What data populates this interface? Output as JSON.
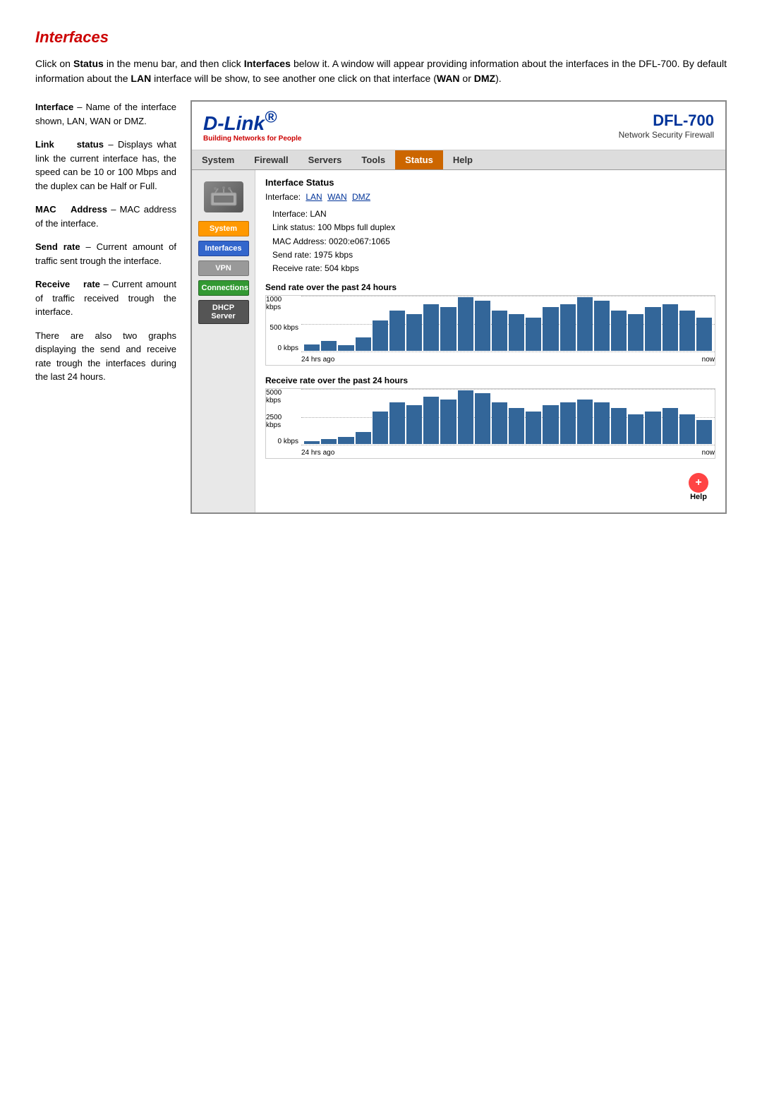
{
  "page": {
    "title": "Interfaces",
    "intro": "Click on Status in the menu bar, and then click Interfaces below it. A window will appear providing information about the interfaces in the DFL-700. By default information about the LAN interface will be show, to see another one click on that interface (WAN or DMZ).",
    "descriptions": [
      {
        "term": "Interface",
        "definition": "– Name of the interface shown, LAN, WAN or DMZ."
      },
      {
        "term": "Link status",
        "definition": "– Displays what link the current interface has, the speed can be 10 or 100 Mbps and the duplex can be Half or Full."
      },
      {
        "term": "MAC Address",
        "definition": "– MAC address of the interface."
      },
      {
        "term": "Send rate",
        "definition": "– Current amount of traffic sent trough the interface."
      },
      {
        "term": "Receive rate",
        "definition": "– Current amount of traffic received trough the interface."
      }
    ],
    "closing_text": "There are also two graphs displaying the send and receive rate trough the interfaces during the last 24 hours."
  },
  "dlink_ui": {
    "logo": "D-Link",
    "logo_r": "®",
    "tagline": "Building Networks for People",
    "product_model": "DFL-700",
    "product_desc": "Network Security Firewall",
    "nav_items": [
      "System",
      "Firewall",
      "Servers",
      "Tools",
      "Status",
      "Help"
    ],
    "active_nav": "Status",
    "sidebar_items": [
      {
        "label": "System",
        "style": "orange"
      },
      {
        "label": "Interfaces",
        "style": "blue"
      },
      {
        "label": "VPN",
        "style": "gray"
      },
      {
        "label": "Connections",
        "style": "green"
      },
      {
        "label": "DHCP Server",
        "style": "dark"
      }
    ],
    "interface_status": {
      "title": "Interface Status",
      "interface_label": "Interface:",
      "interface_links": [
        "LAN",
        "WAN",
        "DMZ"
      ],
      "active_interface": "LAN",
      "details": [
        "Interface: LAN",
        "Link status: 100 Mbps full duplex",
        "MAC Address: 0020:e067:1065",
        "Send rate: 1975 kbps",
        "Receive rate: 504 kbps"
      ]
    },
    "send_chart": {
      "title": "Send rate over the past 24 hours",
      "y_labels": [
        "1000 kbps",
        "500 kbps",
        "0 kbps"
      ],
      "x_labels": [
        "24 hrs ago",
        "now"
      ],
      "bars": [
        10,
        15,
        8,
        20,
        45,
        60,
        55,
        70,
        65,
        80,
        75,
        60,
        55,
        50,
        65,
        70,
        80,
        75,
        60,
        55,
        65,
        70,
        60,
        50
      ]
    },
    "receive_chart": {
      "title": "Receive rate over the past 24 hours",
      "y_labels": [
        "5000 kbps",
        "2500 kbps",
        "0 kbps"
      ],
      "x_labels": [
        "24 hrs ago",
        "now"
      ],
      "bars": [
        5,
        8,
        12,
        20,
        55,
        70,
        65,
        80,
        75,
        90,
        85,
        70,
        60,
        55,
        65,
        70,
        75,
        70,
        60,
        50,
        55,
        60,
        50,
        40
      ]
    },
    "help_label": "Help"
  }
}
